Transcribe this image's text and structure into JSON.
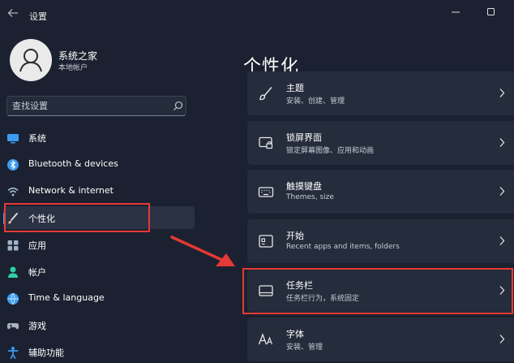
{
  "window": {
    "title": "设置"
  },
  "user": {
    "name": "系统之家",
    "account": "本地帐户"
  },
  "search": {
    "placeholder": "查找设置"
  },
  "nav": {
    "items": [
      {
        "label": "系统",
        "icon": "monitor-icon"
      },
      {
        "label": "Bluetooth & devices",
        "icon": "bluetooth-icon"
      },
      {
        "label": "Network & internet",
        "icon": "wifi-icon"
      },
      {
        "label": "个性化",
        "icon": "brush-icon",
        "selected": true
      },
      {
        "label": "应用",
        "icon": "apps-icon"
      },
      {
        "label": "帐户",
        "icon": "account-icon"
      },
      {
        "label": "Time & language",
        "icon": "globe-icon"
      },
      {
        "label": "游戏",
        "icon": "gamepad-icon"
      },
      {
        "label": "辅助功能",
        "icon": "accessibility-icon"
      }
    ]
  },
  "main": {
    "title": "个性化",
    "cards": [
      {
        "title": "主题",
        "subtitle": "安装、创建、管理",
        "icon": "brush-icon"
      },
      {
        "title": "锁屏界面",
        "subtitle": "锁定屏幕图像、应用和动画",
        "icon": "lock-screen-icon"
      },
      {
        "title": "触摸键盘",
        "subtitle": "Themes, size",
        "icon": "keyboard-icon"
      },
      {
        "title": "开始",
        "subtitle": "Recent apps and items, folders",
        "icon": "start-icon"
      },
      {
        "title": "任务栏",
        "subtitle": "任务栏行为，系统固定",
        "icon": "taskbar-icon",
        "highlighted": true
      },
      {
        "title": "字体",
        "subtitle": "安装、管理",
        "icon": "font-icon"
      }
    ]
  },
  "colors": {
    "background": "#1b2130",
    "card": "#252c3c",
    "accent": "#4aa3ff",
    "annotation": "#e53935"
  }
}
